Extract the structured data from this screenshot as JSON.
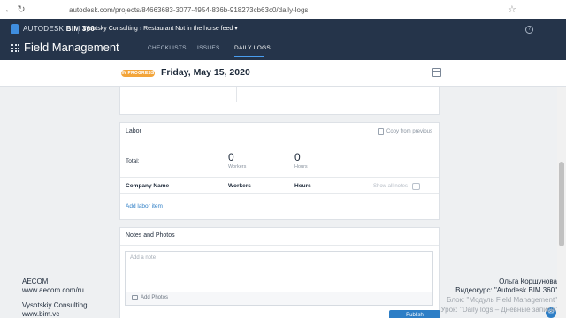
{
  "browser": {
    "url": "autodesk.com/projects/84663683-3077-4954-836b-918273cb63c0/daily-logs"
  },
  "header": {
    "brand_prefix": "AUTODESK",
    "brand_product": "BIM 360",
    "account": "Vysotsky Consulting",
    "project": "Restaurant Not in the horse feed",
    "module_title": "Field Management",
    "tabs": [
      {
        "label": "CHECKLISTS"
      },
      {
        "label": "ISSUES"
      },
      {
        "label": "DAILY LOGS"
      }
    ],
    "active_tab": "DAILY LOGS"
  },
  "log": {
    "status": "IN PROGRESS",
    "date": "Friday, May 15, 2020"
  },
  "labor": {
    "title": "Labor",
    "copy_label": "Copy from previous",
    "total_label": "Total:",
    "workers_value": "0",
    "workers_caption": "Workers",
    "hours_value": "0",
    "hours_caption": "Hours",
    "columns": [
      "Company Name",
      "Workers",
      "Hours"
    ],
    "show_notes_label": "Show all notes",
    "add_item_label": "Add labor item"
  },
  "notes": {
    "title": "Notes and Photos",
    "placeholder": "Add a note",
    "add_photos_label": "Add Photos"
  },
  "footer": {
    "publish_label": "Publish"
  },
  "overlay": {
    "left": [
      "AECOM",
      "www.aecom.com/ru",
      "Vysotskiy Consulting",
      "www.bim.vc"
    ],
    "right": [
      "Ольга Коршунова",
      "Видеокурс: \"Autodesk BIM 360\"",
      "Блок: \"Модуль Field Management\"",
      "Урок: \"Daily logs – Дневные записи\""
    ]
  },
  "icons": {
    "back": "arrow-left-icon",
    "reload": "reload-icon",
    "star": "star-icon",
    "help": "help-icon",
    "apps": "grid-icon",
    "calendar": "calendar-icon",
    "copy": "copy-icon",
    "photo": "camera-icon",
    "chat": "chat-icon"
  },
  "colors": {
    "header_bg": "#25344a",
    "accent_blue": "#2d7ec6",
    "status_orange": "#f3a53a"
  }
}
